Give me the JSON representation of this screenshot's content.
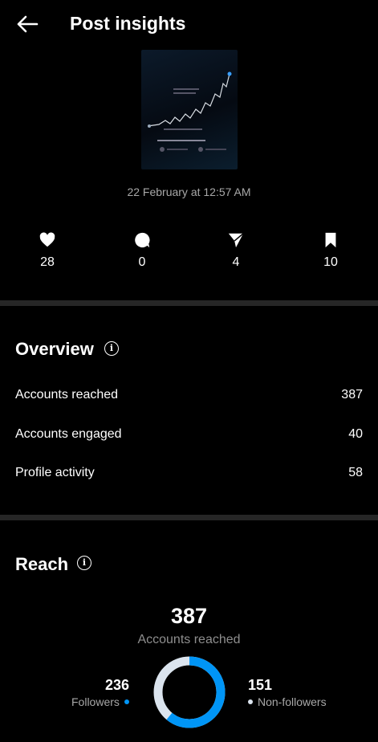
{
  "header": {
    "title": "Post insights"
  },
  "post": {
    "date": "22 February at 12:57 AM"
  },
  "stats": [
    {
      "icon": "heart-icon",
      "value": "28"
    },
    {
      "icon": "comment-icon",
      "value": "0"
    },
    {
      "icon": "share-icon",
      "value": "4"
    },
    {
      "icon": "bookmark-icon",
      "value": "10"
    }
  ],
  "overview": {
    "title": "Overview",
    "rows": [
      {
        "label": "Accounts reached",
        "value": "387"
      },
      {
        "label": "Accounts engaged",
        "value": "40"
      },
      {
        "label": "Profile activity",
        "value": "58"
      }
    ]
  },
  "reach": {
    "title": "Reach",
    "total": "387",
    "total_label": "Accounts reached",
    "followers": {
      "value": "236",
      "label": "Followers"
    },
    "non_followers": {
      "value": "151",
      "label": "Non-followers"
    },
    "followers_fraction": 0.61
  },
  "colors": {
    "accent": "#0095f6",
    "secondary": "#dbe4ee",
    "divider": "#262626"
  }
}
